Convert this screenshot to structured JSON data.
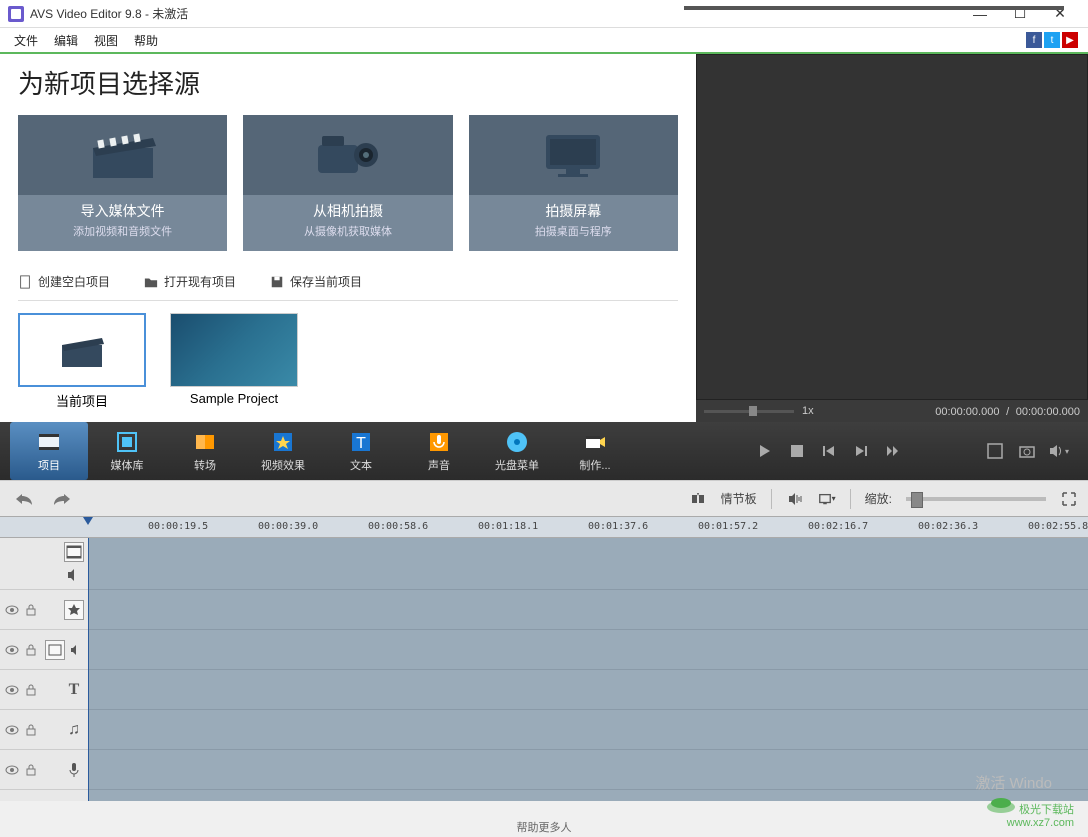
{
  "window": {
    "title": "AVS Video Editor 9.8 - 未激活",
    "min": "—",
    "max": "☐",
    "close": "✕"
  },
  "menu": {
    "file": "文件",
    "edit": "编辑",
    "view": "视图",
    "help": "帮助"
  },
  "social": {
    "facebook": "f",
    "twitter": "t",
    "youtube": "▶"
  },
  "heading": "为新项目选择源",
  "cards": [
    {
      "title": "导入媒体文件",
      "sub": "添加视频和音频文件"
    },
    {
      "title": "从相机拍摄",
      "sub": "从摄像机获取媒体"
    },
    {
      "title": "拍摄屏幕",
      "sub": "拍摄桌面与程序"
    }
  ],
  "actions": {
    "blank": "创建空白项目",
    "open": "打开现有项目",
    "save": "保存当前项目"
  },
  "projects": [
    {
      "label": "当前项目"
    },
    {
      "label": "Sample Project"
    }
  ],
  "preview": {
    "speed": "1x",
    "current": "00:00:00.000",
    "sep": "/",
    "total": "00:00:00.000"
  },
  "tabs": [
    {
      "id": "project",
      "label": "项目"
    },
    {
      "id": "library",
      "label": "媒体库"
    },
    {
      "id": "transition",
      "label": "转场"
    },
    {
      "id": "videofx",
      "label": "视频效果"
    },
    {
      "id": "text",
      "label": "文本"
    },
    {
      "id": "voice",
      "label": "声音"
    },
    {
      "id": "disc",
      "label": "光盘菜单"
    },
    {
      "id": "produce",
      "label": "制作..."
    }
  ],
  "tl": {
    "storyboard": "情节板",
    "zoom": "缩放:"
  },
  "ruler": [
    "00:00:19.5",
    "00:00:39.0",
    "00:00:58.6",
    "00:01:18.1",
    "00:01:37.6",
    "00:01:57.2",
    "00:02:16.7",
    "00:02:36.3",
    "00:02:55.8"
  ],
  "status": "帮助更多人",
  "watermark": {
    "name": "极光下载站",
    "url": "www.xz7.com"
  },
  "activate": "激活 Windo"
}
